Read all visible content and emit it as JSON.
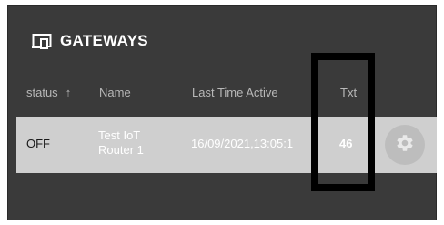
{
  "header": {
    "icon": "devices-icon",
    "title": "GATEWAYS"
  },
  "table": {
    "columns": {
      "status": "status",
      "status_sort_icon": "arrow-up-icon",
      "name": "Name",
      "last_time_active": "Last Time Active",
      "txt": "Txt"
    },
    "rows": [
      {
        "status": "OFF",
        "name": "Test IoT Router 1",
        "last_time_active": "16/09/2021,13:05:1",
        "txt": "46",
        "action_icon": "gear-icon"
      }
    ]
  },
  "colors": {
    "panel_background": "#3a3a3a",
    "row_background": "#cfcfcf",
    "highlight_box": "#000000"
  }
}
